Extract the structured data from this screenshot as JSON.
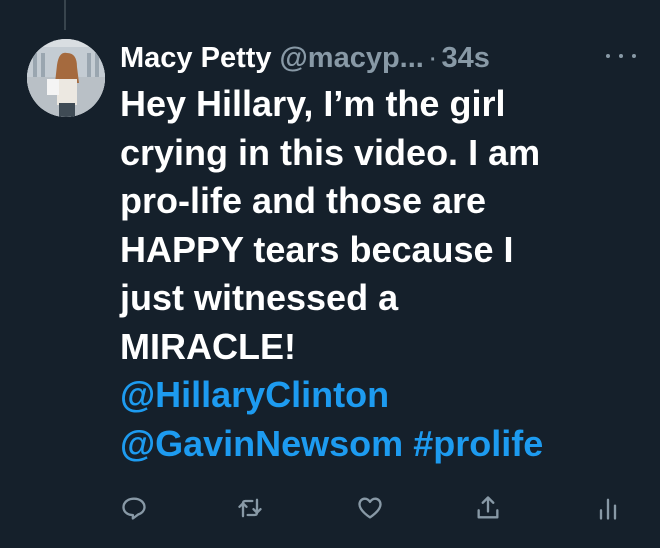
{
  "tweet": {
    "display_name": "Macy Petty",
    "handle": "@macyp...",
    "separator": "·",
    "time": "34s",
    "text_lines": [
      "Hey Hillary, I’m the girl",
      "crying in this video. I am",
      "pro-life and those are",
      "HAPPY tears because I",
      "just witnessed a",
      "MIRACLE!"
    ],
    "mention_1": "@HillaryClinton",
    "mention_2": "@GavinNewsom",
    "hashtag": "#prolife"
  },
  "actions": {
    "icons": [
      "reply-icon",
      "retweet-icon",
      "like-icon",
      "share-icon",
      "analytics-icon"
    ]
  },
  "colors": {
    "background": "#15202b",
    "text": "#ffffff",
    "secondary": "#8899a6",
    "link": "#1d9bf0"
  }
}
